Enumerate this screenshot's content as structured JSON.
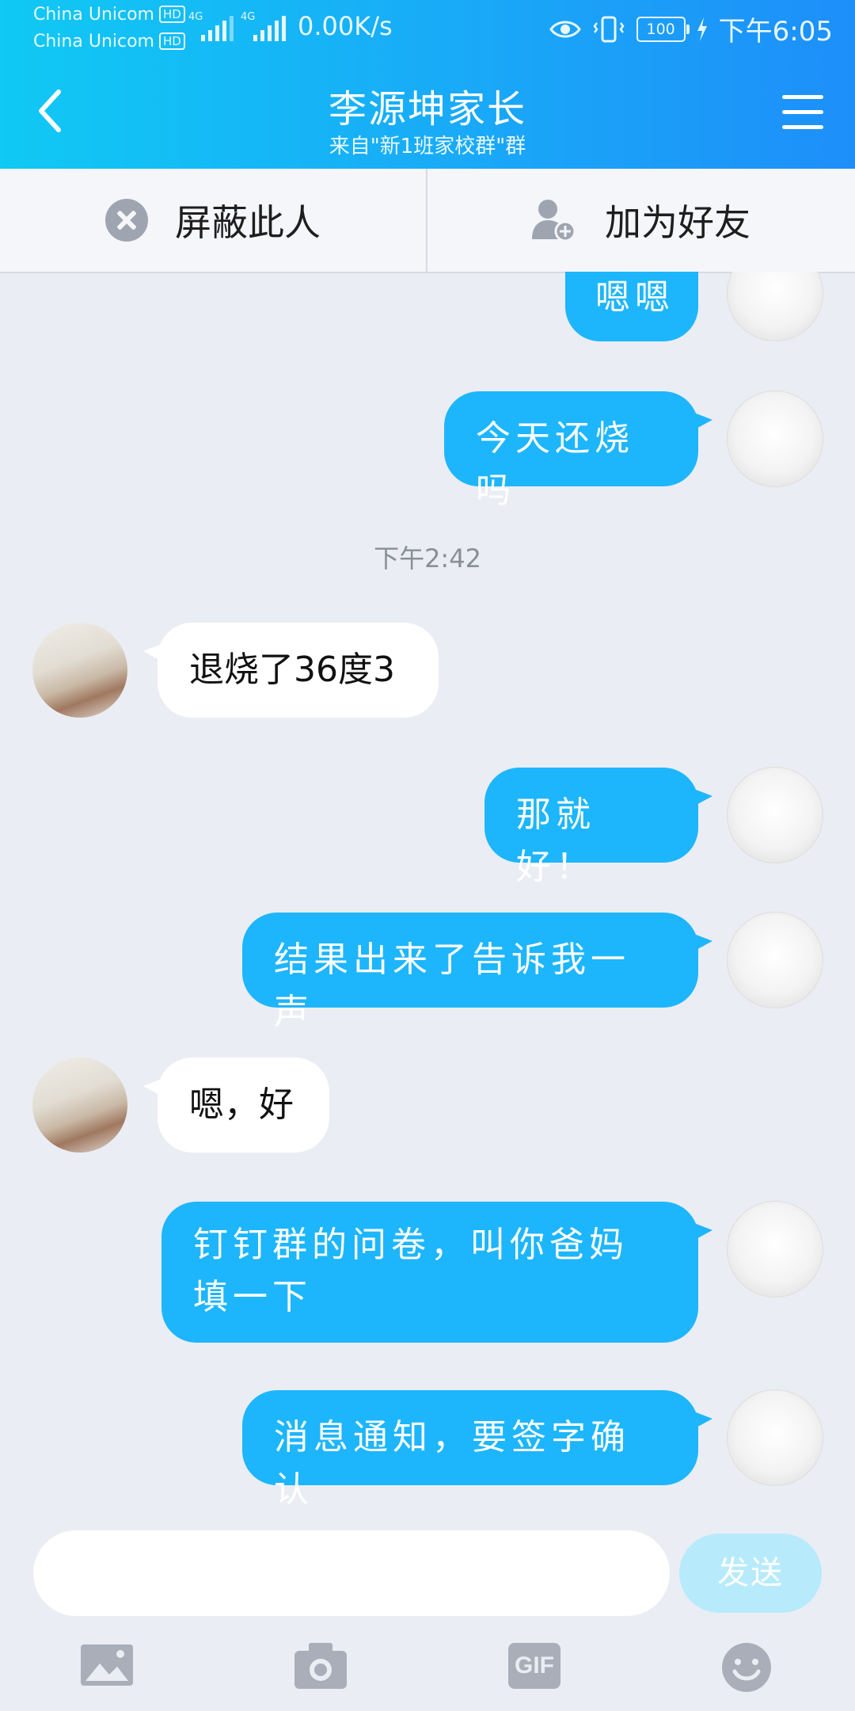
{
  "status_bar": {
    "carrier_1": "China Unicom",
    "carrier_2": "China Unicom",
    "hd_badge": "HD",
    "network_label": "4G",
    "speed": "0.00K/s",
    "battery": "100",
    "time": "下午6:05",
    "icons": [
      "eye-icon",
      "vibrate-icon",
      "battery-icon",
      "charging-icon"
    ]
  },
  "header": {
    "title": "李源坤家长",
    "subtitle": "来自\"新1班家校群\"群"
  },
  "actions": {
    "block_label": "屏蔽此人",
    "add_friend_label": "加为好友"
  },
  "messages": [
    {
      "side": "out",
      "text": "嗯嗯"
    },
    {
      "side": "out",
      "text": "今天还烧吗"
    },
    {
      "side": "in",
      "text": "退烧了36度3"
    },
    {
      "side": "out",
      "text": "那就好！"
    },
    {
      "side": "out",
      "text": "结果出来了告诉我一声"
    },
    {
      "side": "in",
      "text": "嗯，好"
    },
    {
      "side": "out",
      "text": "钉钉群的问卷，叫你爸妈填一下"
    },
    {
      "side": "out",
      "text": "消息通知，要签字确认"
    }
  ],
  "timestamp": "下午2:42",
  "composer": {
    "placeholder": "",
    "send_label": "发送"
  },
  "toolbar": {
    "gif_label": "GIF",
    "tools": [
      "image-icon",
      "camera-icon",
      "gif-icon",
      "emoji-icon"
    ]
  },
  "colors": {
    "header_gradient_start": "#10c9f4",
    "header_gradient_end": "#1d8ff9",
    "outgoing_bubble": "#1db6fc",
    "incoming_bubble": "#ffffff",
    "chat_background": "#ebedf4",
    "send_button_disabled": "#b7ebfb"
  }
}
